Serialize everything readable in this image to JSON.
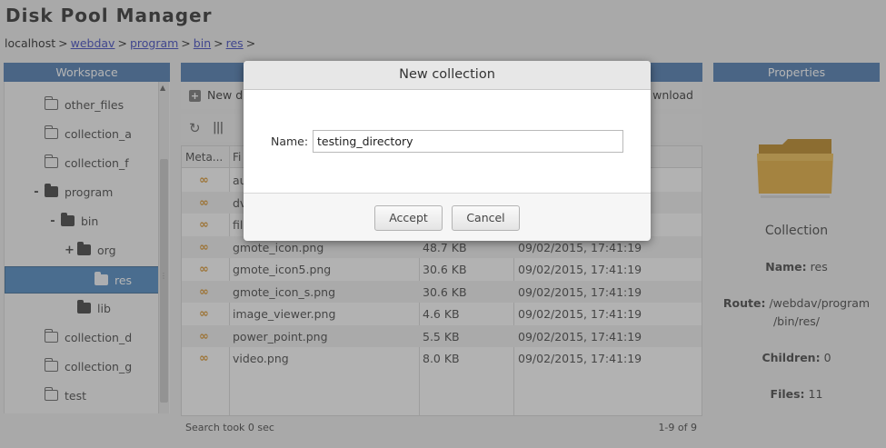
{
  "app": {
    "title": "Disk Pool Manager"
  },
  "breadcrumb": {
    "root": "localhost",
    "separator": ">",
    "links": [
      "webdav",
      "program",
      "bin",
      "res"
    ],
    "trailing": ">"
  },
  "panels": {
    "workspace": "Workspace",
    "center": "",
    "properties": "Properties"
  },
  "tree": {
    "items": [
      {
        "label": "other_files",
        "toggle": "",
        "folder": "outline",
        "selected": false
      },
      {
        "label": "collection_a",
        "toggle": "",
        "folder": "outline",
        "selected": false
      },
      {
        "label": "collection_f",
        "toggle": "",
        "folder": "outline",
        "selected": false
      },
      {
        "label": "program",
        "toggle": "-",
        "folder": "solid",
        "selected": false
      },
      {
        "label": "bin",
        "toggle": "-",
        "folder": "solid",
        "selected": false
      },
      {
        "label": "org",
        "toggle": "+",
        "folder": "solid",
        "selected": false
      },
      {
        "label": "res",
        "toggle": "",
        "folder": "white",
        "selected": true
      },
      {
        "label": "lib",
        "toggle": "",
        "folder": "solid",
        "selected": false
      },
      {
        "label": "collection_d",
        "toggle": "",
        "folder": "outline",
        "selected": false
      },
      {
        "label": "collection_g",
        "toggle": "",
        "folder": "outline",
        "selected": false
      },
      {
        "label": "test",
        "toggle": "",
        "folder": "outline",
        "selected": false
      }
    ]
  },
  "toolbar": {
    "new_dir_label": "New d",
    "download_label": "wnload"
  },
  "grid": {
    "headers": {
      "meta": "Meta...",
      "file": "Fi",
      "size": "",
      "date": ""
    },
    "rows": [
      {
        "name": "au",
        "size": "",
        "date": ""
      },
      {
        "name": "dv",
        "size": "",
        "date": ""
      },
      {
        "name": "fil",
        "size": "",
        "date": ""
      },
      {
        "name": "gmote_icon.png",
        "size": "48.7 KB",
        "date": "09/02/2015, 17:41:19"
      },
      {
        "name": "gmote_icon5.png",
        "size": "30.6 KB",
        "date": "09/02/2015, 17:41:19"
      },
      {
        "name": "gmote_icon_s.png",
        "size": "30.6 KB",
        "date": "09/02/2015, 17:41:19"
      },
      {
        "name": "image_viewer.png",
        "size": "4.6 KB",
        "date": "09/02/2015, 17:41:19"
      },
      {
        "name": "power_point.png",
        "size": "5.5 KB",
        "date": "09/02/2015, 17:41:19"
      },
      {
        "name": "video.png",
        "size": "8.0 KB",
        "date": "09/02/2015, 17:41:19"
      }
    ]
  },
  "status": {
    "search_time": "Search took 0 sec",
    "paging": "1-9 of 9"
  },
  "properties": {
    "type": "Collection",
    "name_label": "Name:",
    "name_value": "res",
    "route_label": "Route:",
    "route_value_1": "/webdav/program",
    "route_value_2": "/bin/res/",
    "children_label": "Children:",
    "children_value": "0",
    "files_label": "Files:",
    "files_value": "11"
  },
  "dialog": {
    "title": "New collection",
    "name_label": "Name:",
    "name_value": "testing_directory",
    "accept_label": "Accept",
    "cancel_label": "Cancel"
  }
}
